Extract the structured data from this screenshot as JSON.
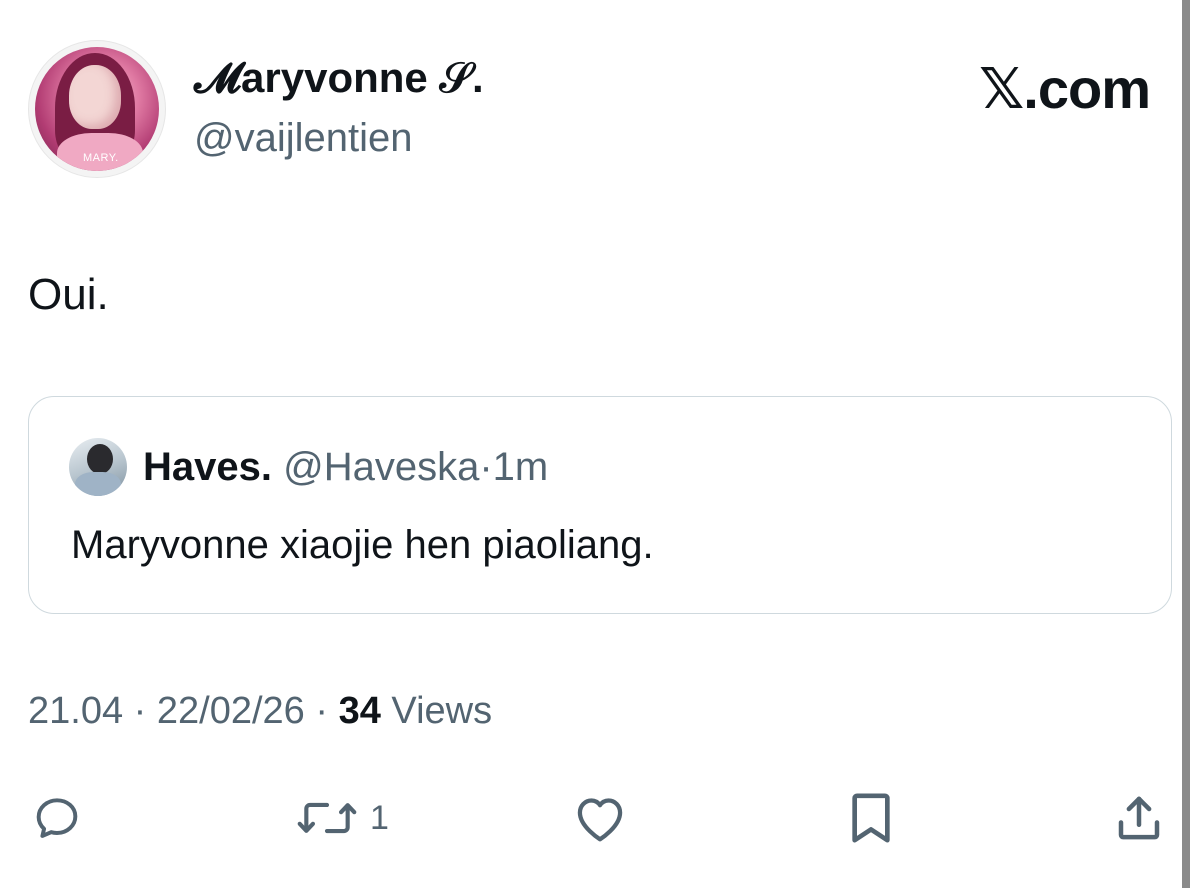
{
  "author": {
    "display_name": "𝓜aryvonne 𝒮.",
    "handle": "@vaijlentien",
    "avatar_label": "MARY."
  },
  "brand": "𝕏.com",
  "tweet": {
    "text": "Oui."
  },
  "quoted_tweet": {
    "name": "Haves.",
    "handle": "@Haveska",
    "separator": "·",
    "time": "1m",
    "text": "Maryvonne xiaojie hen piaoliang."
  },
  "meta": {
    "time": "21.04",
    "separator": "·",
    "date": "22/02/26",
    "views_count": "34",
    "views_label": "Views"
  },
  "actions": {
    "reply": {
      "icon": "reply-icon"
    },
    "repost": {
      "icon": "repost-icon",
      "count": "1"
    },
    "like": {
      "icon": "heart-icon"
    },
    "bookmark": {
      "icon": "bookmark-icon"
    },
    "share": {
      "icon": "share-icon"
    }
  },
  "colors": {
    "text": "#0f1419",
    "secondary": "#536471",
    "border": "#cfd9de"
  }
}
